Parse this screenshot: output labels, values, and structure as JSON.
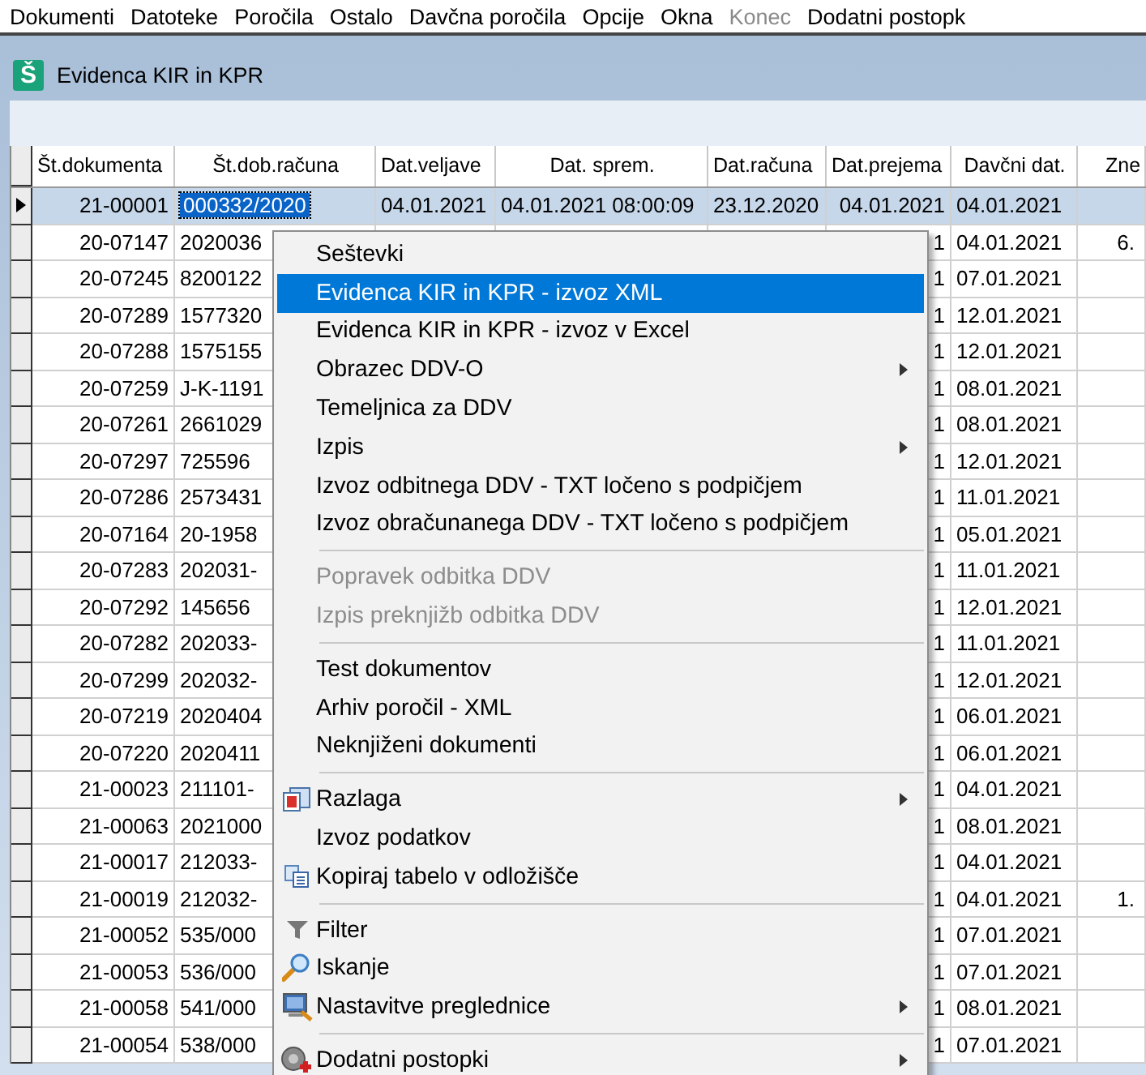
{
  "menubar": [
    {
      "label": "Dokumenti",
      "disabled": false
    },
    {
      "label": "Datoteke",
      "disabled": false
    },
    {
      "label": "Poročila",
      "disabled": false
    },
    {
      "label": "Ostalo",
      "disabled": false
    },
    {
      "label": "Davčna poročila",
      "disabled": false
    },
    {
      "label": "Opcije",
      "disabled": false
    },
    {
      "label": "Okna",
      "disabled": false
    },
    {
      "label": "Konec",
      "disabled": true
    },
    {
      "label": "Dodatni postopk",
      "disabled": false
    }
  ],
  "window": {
    "icon_letter": "Š",
    "title": "Evidenca KIR in KPR"
  },
  "table": {
    "columns": [
      "Št.dokumenta",
      "Št.dob.računa",
      "Dat.veljave",
      "Dat. sprem.",
      "Dat.računa",
      "Dat.prejema",
      "Davčni dat.",
      "Zne"
    ],
    "rows": [
      {
        "selected": true,
        "cells": [
          "21-00001",
          "000332/2020",
          "04.01.2021",
          "04.01.2021 08:00:09",
          "23.12.2020",
          "04.01.2021",
          "04.01.2021",
          null
        ]
      },
      {
        "selected": false,
        "cells": [
          "20-07147",
          "2020036",
          null,
          null,
          null,
          "1",
          "04.01.2021",
          "6."
        ]
      },
      {
        "selected": false,
        "cells": [
          "20-07245",
          "8200122",
          null,
          null,
          null,
          "1",
          "07.01.2021",
          null
        ]
      },
      {
        "selected": false,
        "cells": [
          "20-07289",
          "1577320",
          null,
          null,
          null,
          "1",
          "12.01.2021",
          null
        ]
      },
      {
        "selected": false,
        "cells": [
          "20-07288",
          "1575155",
          null,
          null,
          null,
          "1",
          "12.01.2021",
          null
        ]
      },
      {
        "selected": false,
        "cells": [
          "20-07259",
          "J-K-1191",
          null,
          null,
          null,
          "1",
          "08.01.2021",
          null
        ]
      },
      {
        "selected": false,
        "cells": [
          "20-07261",
          "2661029",
          null,
          null,
          null,
          "1",
          "08.01.2021",
          null
        ]
      },
      {
        "selected": false,
        "cells": [
          "20-07297",
          "725596",
          null,
          null,
          null,
          "1",
          "12.01.2021",
          null
        ]
      },
      {
        "selected": false,
        "cells": [
          "20-07286",
          "2573431",
          null,
          null,
          null,
          "1",
          "11.01.2021",
          null
        ]
      },
      {
        "selected": false,
        "cells": [
          "20-07164",
          "20-1958",
          null,
          null,
          null,
          "1",
          "05.01.2021",
          null
        ]
      },
      {
        "selected": false,
        "cells": [
          "20-07283",
          "202031-",
          null,
          null,
          null,
          "1",
          "11.01.2021",
          null
        ]
      },
      {
        "selected": false,
        "cells": [
          "20-07292",
          "145656",
          null,
          null,
          null,
          "1",
          "12.01.2021",
          null
        ]
      },
      {
        "selected": false,
        "cells": [
          "20-07282",
          "202033-",
          null,
          null,
          null,
          "1",
          "11.01.2021",
          null
        ]
      },
      {
        "selected": false,
        "cells": [
          "20-07299",
          "202032-",
          null,
          null,
          null,
          "1",
          "12.01.2021",
          null
        ]
      },
      {
        "selected": false,
        "cells": [
          "20-07219",
          "2020404",
          null,
          null,
          null,
          "1",
          "06.01.2021",
          null
        ]
      },
      {
        "selected": false,
        "cells": [
          "20-07220",
          "2020411",
          null,
          null,
          null,
          "1",
          "06.01.2021",
          null
        ]
      },
      {
        "selected": false,
        "cells": [
          "21-00023",
          "211101-",
          null,
          null,
          null,
          "1",
          "04.01.2021",
          null
        ]
      },
      {
        "selected": false,
        "cells": [
          "21-00063",
          "2021000",
          null,
          null,
          null,
          "1",
          "08.01.2021",
          null
        ]
      },
      {
        "selected": false,
        "cells": [
          "21-00017",
          "212033-",
          null,
          null,
          null,
          "1",
          "04.01.2021",
          null
        ]
      },
      {
        "selected": false,
        "cells": [
          "21-00019",
          "212032-",
          null,
          null,
          null,
          "1",
          "04.01.2021",
          "1."
        ]
      },
      {
        "selected": false,
        "cells": [
          "21-00052",
          "535/000",
          null,
          null,
          null,
          "1",
          "07.01.2021",
          null
        ]
      },
      {
        "selected": false,
        "cells": [
          "21-00053",
          "536/000",
          null,
          null,
          null,
          "1",
          "07.01.2021",
          null
        ]
      },
      {
        "selected": false,
        "cells": [
          "21-00058",
          "541/000",
          null,
          null,
          null,
          "1",
          "08.01.2021",
          null
        ]
      },
      {
        "selected": false,
        "cells": [
          "21-00054",
          "538/000",
          null,
          null,
          null,
          "1",
          "07.01.2021",
          null
        ]
      }
    ]
  },
  "context_menu": {
    "items": [
      {
        "kind": "item",
        "label": "Seštevki",
        "selected": false,
        "disabled": false,
        "submenu": false
      },
      {
        "kind": "item",
        "label": "Evidenca KIR in KPR - izvoz XML",
        "selected": true,
        "disabled": false,
        "submenu": false
      },
      {
        "kind": "item",
        "label": "Evidenca KIR in KPR - izvoz v Excel",
        "selected": false,
        "disabled": false,
        "submenu": false
      },
      {
        "kind": "item",
        "label": "Obrazec DDV-O",
        "selected": false,
        "disabled": false,
        "submenu": true
      },
      {
        "kind": "item",
        "label": "Temeljnica za DDV",
        "selected": false,
        "disabled": false,
        "submenu": false
      },
      {
        "kind": "item",
        "label": "Izpis",
        "selected": false,
        "disabled": false,
        "submenu": true
      },
      {
        "kind": "item",
        "label": "Izvoz odbitnega DDV - TXT ločeno s podpičjem",
        "selected": false,
        "disabled": false,
        "submenu": false
      },
      {
        "kind": "item",
        "label": "Izvoz obračunanega DDV - TXT ločeno s podpičjem",
        "selected": false,
        "disabled": false,
        "submenu": false
      },
      {
        "kind": "separator"
      },
      {
        "kind": "item",
        "label": "Popravek odbitka DDV",
        "selected": false,
        "disabled": true,
        "submenu": false
      },
      {
        "kind": "item",
        "label": "Izpis preknjižb odbitka DDV",
        "selected": false,
        "disabled": true,
        "submenu": false
      },
      {
        "kind": "separator"
      },
      {
        "kind": "item",
        "label": "Test dokumentov",
        "selected": false,
        "disabled": false,
        "submenu": false
      },
      {
        "kind": "item",
        "label": "Arhiv poročil - XML",
        "selected": false,
        "disabled": false,
        "submenu": false
      },
      {
        "kind": "item",
        "label": "Neknjiženi dokumenti",
        "selected": false,
        "disabled": false,
        "submenu": false
      },
      {
        "kind": "separator"
      },
      {
        "kind": "item",
        "label": "Razlaga",
        "selected": false,
        "disabled": false,
        "submenu": true
      },
      {
        "kind": "item",
        "label": "Izvoz podatkov",
        "selected": false,
        "disabled": false,
        "submenu": false
      },
      {
        "kind": "item",
        "label": "Kopiraj tabelo v odložišče",
        "selected": false,
        "disabled": false,
        "submenu": false
      },
      {
        "kind": "separator"
      },
      {
        "kind": "item",
        "label": "Filter",
        "selected": false,
        "disabled": false,
        "submenu": false
      },
      {
        "kind": "item",
        "label": "Iskanje",
        "selected": false,
        "disabled": false,
        "submenu": false
      },
      {
        "kind": "item",
        "label": "Nastavitve preglednice",
        "selected": false,
        "disabled": false,
        "submenu": true
      },
      {
        "kind": "separator"
      },
      {
        "kind": "item",
        "label": "Dodatni postopki",
        "selected": false,
        "disabled": false,
        "submenu": true
      }
    ]
  }
}
